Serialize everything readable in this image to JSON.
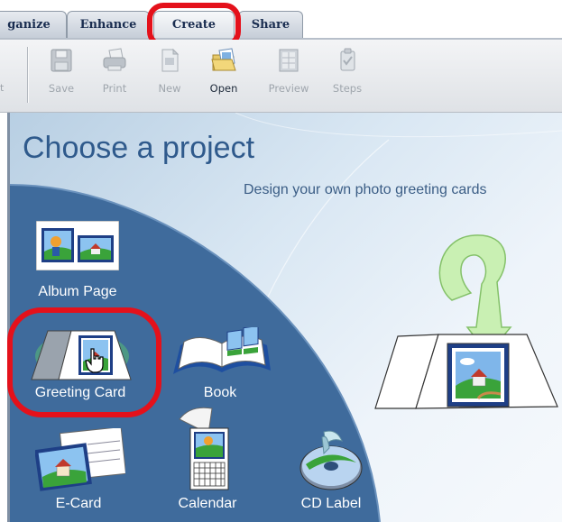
{
  "tabs": [
    {
      "label": "ganize"
    },
    {
      "label": "Enhance"
    },
    {
      "label": "Create",
      "active": true
    },
    {
      "label": "Share"
    }
  ],
  "toolbar": {
    "left_partial_label": "t",
    "tools": [
      {
        "label": "Save",
        "icon": "save-icon",
        "enabled": false
      },
      {
        "label": "Print",
        "icon": "print-icon",
        "enabled": false
      },
      {
        "label": "New",
        "icon": "new-icon",
        "enabled": false
      },
      {
        "label": "Open",
        "icon": "open-icon",
        "enabled": true
      },
      {
        "label": "Preview",
        "icon": "preview-icon",
        "enabled": false
      },
      {
        "label": "Steps",
        "icon": "steps-icon",
        "enabled": false
      }
    ]
  },
  "main": {
    "title": "Choose a project",
    "subtitle": "Design your own photo greeting cards",
    "projects": [
      {
        "label": "Album Page",
        "icon": "album-page-icon"
      },
      {
        "label": "Greeting Card",
        "icon": "greeting-card-icon",
        "selected": true
      },
      {
        "label": "Book",
        "icon": "book-icon"
      },
      {
        "label": "E-Card",
        "icon": "ecard-icon"
      },
      {
        "label": "Calendar",
        "icon": "calendar-icon"
      },
      {
        "label": "CD Label",
        "icon": "cd-label-icon"
      }
    ]
  },
  "colors": {
    "accent_highlight": "#e4111b",
    "panel_blue": "#3f6b9c",
    "title_blue": "#2f5a8c"
  }
}
